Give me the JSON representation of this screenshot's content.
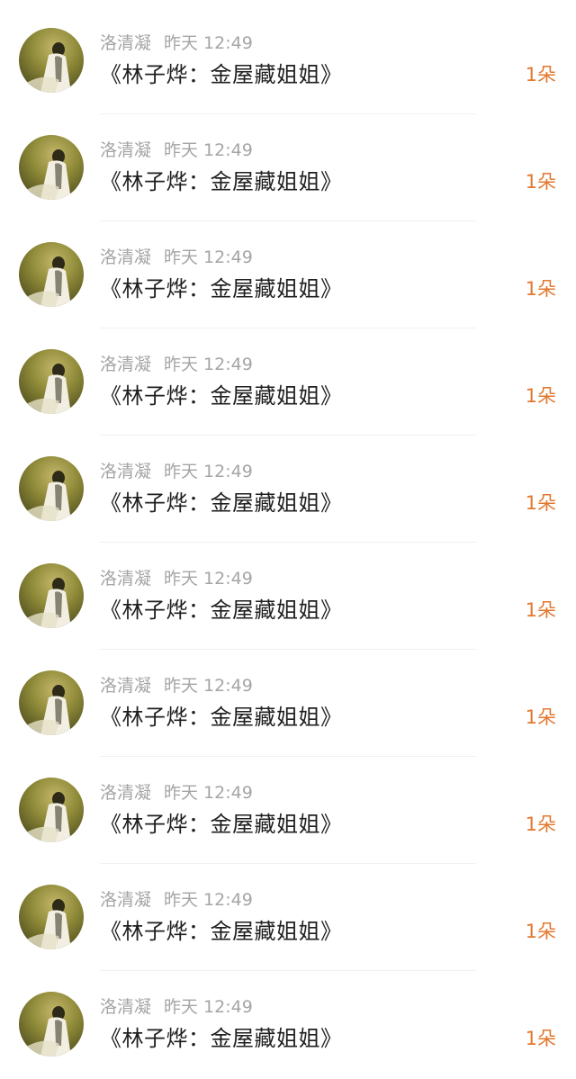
{
  "gifts": [
    {
      "name": "洛清凝",
      "time": "昨天 12:49",
      "title": "《林子烨：金屋藏姐姐》",
      "count": "1朵",
      "avatar": "avatar-photo"
    },
    {
      "name": "洛清凝",
      "time": "昨天 12:49",
      "title": "《林子烨：金屋藏姐姐》",
      "count": "1朵",
      "avatar": "avatar-photo"
    },
    {
      "name": "洛清凝",
      "time": "昨天 12:49",
      "title": "《林子烨：金屋藏姐姐》",
      "count": "1朵",
      "avatar": "avatar-photo"
    },
    {
      "name": "洛清凝",
      "time": "昨天 12:49",
      "title": "《林子烨：金屋藏姐姐》",
      "count": "1朵",
      "avatar": "avatar-photo"
    },
    {
      "name": "洛清凝",
      "time": "昨天 12:49",
      "title": "《林子烨：金屋藏姐姐》",
      "count": "1朵",
      "avatar": "avatar-photo"
    },
    {
      "name": "洛清凝",
      "time": "昨天 12:49",
      "title": "《林子烨：金屋藏姐姐》",
      "count": "1朵",
      "avatar": "avatar-photo"
    },
    {
      "name": "洛清凝",
      "time": "昨天 12:49",
      "title": "《林子烨：金屋藏姐姐》",
      "count": "1朵",
      "avatar": "avatar-photo"
    },
    {
      "name": "洛清凝",
      "time": "昨天 12:49",
      "title": "《林子烨：金屋藏姐姐》",
      "count": "1朵",
      "avatar": "avatar-photo"
    },
    {
      "name": "洛清凝",
      "time": "昨天 12:49",
      "title": "《林子烨：金屋藏姐姐》",
      "count": "1朵",
      "avatar": "avatar-photo"
    },
    {
      "name": "洛清凝",
      "time": "昨天 12:49",
      "title": "《林子烨：金屋藏姐姐》",
      "count": "1朵",
      "avatar": "avatar-photo"
    }
  ],
  "colors": {
    "name_text": "#a5a5a5",
    "title_text": "#1f1f1f",
    "count_text": "#e3782f",
    "background": "#ffffff"
  }
}
